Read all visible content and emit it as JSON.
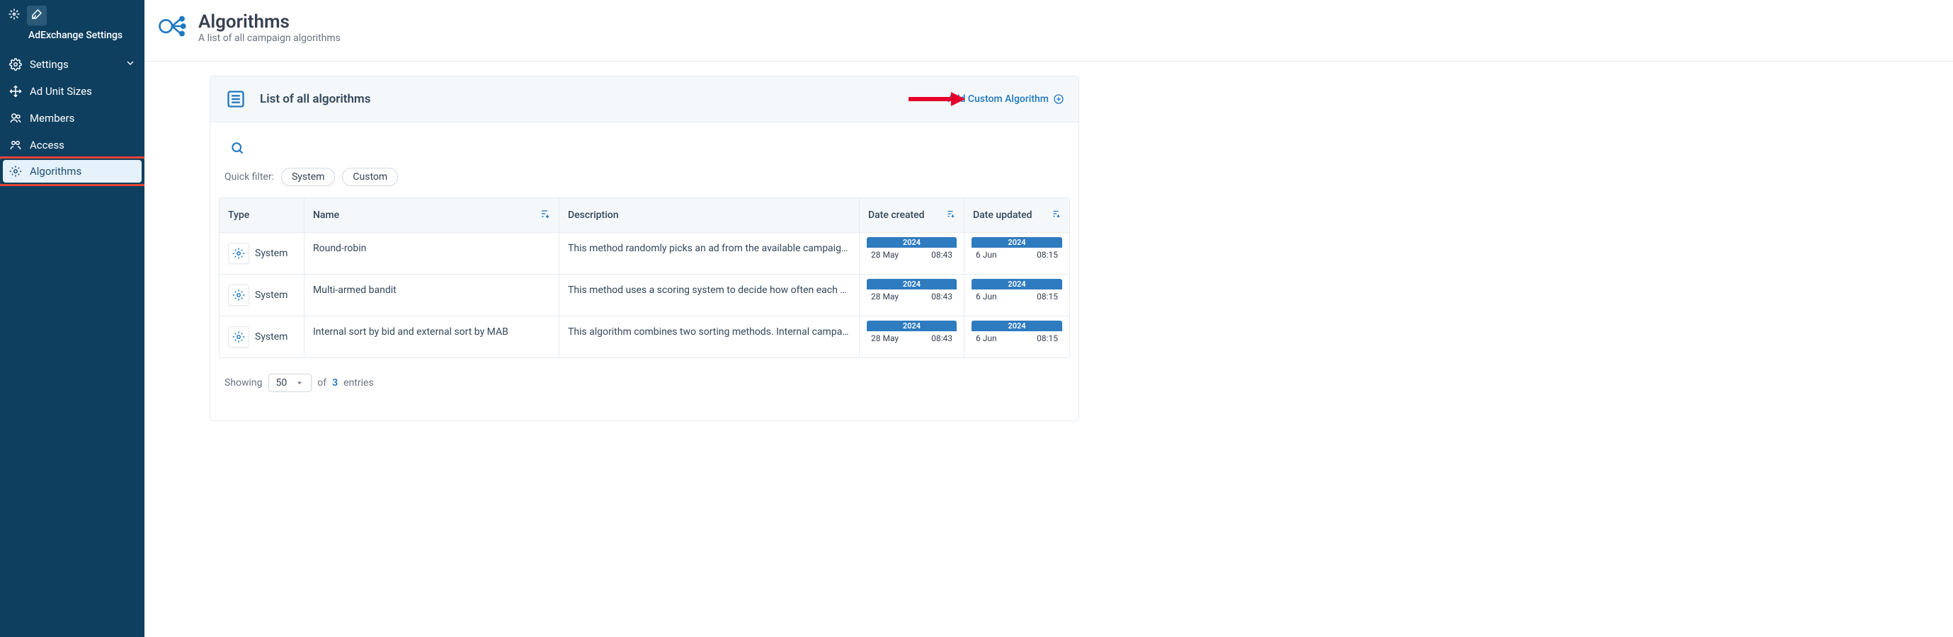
{
  "brand": "AdExchange Settings",
  "sidebar": {
    "items": [
      {
        "label": "Settings"
      },
      {
        "label": "Ad Unit Sizes"
      },
      {
        "label": "Members"
      },
      {
        "label": "Access"
      },
      {
        "label": "Algorithms"
      }
    ]
  },
  "header": {
    "title": "Algorithms",
    "subtitle": "A list of all campaign algorithms"
  },
  "card": {
    "title": "List of all algorithms",
    "add_label": "Add Custom Algorithm",
    "quick_filter_label": "Quick filter:",
    "filters": {
      "system": "System",
      "custom": "Custom"
    }
  },
  "table": {
    "columns": {
      "type": "Type",
      "name": "Name",
      "description": "Description",
      "created": "Date created",
      "updated": "Date updated"
    },
    "rows": [
      {
        "type": "System",
        "name": "Round-robin",
        "description": "This method randomly picks an ad from the available campaigns, ensu…",
        "created": {
          "year": "2024",
          "date": "28 May",
          "time": "08:43"
        },
        "updated": {
          "year": "2024",
          "date": "6 Jun",
          "time": "08:15"
        }
      },
      {
        "type": "System",
        "name": "Multi-armed bandit",
        "description": "This method uses a scoring system to decide how often each campaig…",
        "created": {
          "year": "2024",
          "date": "28 May",
          "time": "08:43"
        },
        "updated": {
          "year": "2024",
          "date": "6 Jun",
          "time": "08:15"
        }
      },
      {
        "type": "System",
        "name": "Internal sort by bid and external sort by MAB",
        "description": "This algorithm combines two sorting methods. Internal campaigns (tho…",
        "created": {
          "year": "2024",
          "date": "28 May",
          "time": "08:43"
        },
        "updated": {
          "year": "2024",
          "date": "6 Jun",
          "time": "08:15"
        }
      }
    ]
  },
  "footer": {
    "showing": "Showing",
    "page_size": "50",
    "of": "of",
    "count": "3",
    "entries": "entries"
  }
}
